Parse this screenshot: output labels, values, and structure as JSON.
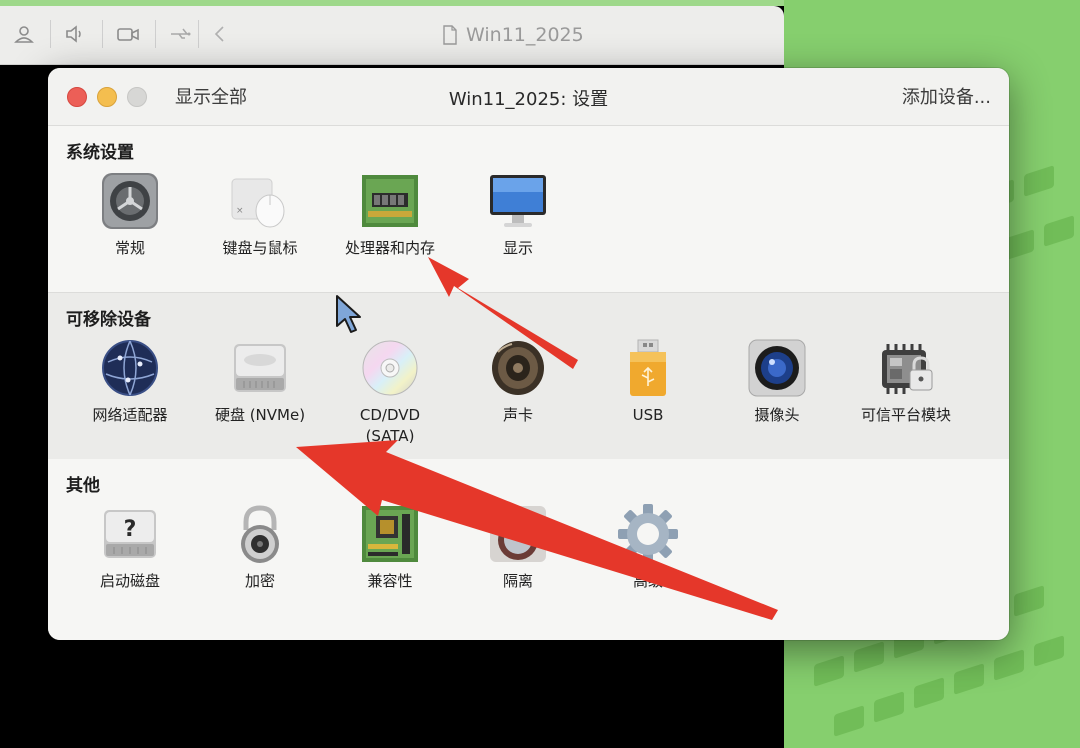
{
  "vm_window": {
    "title": "Win11_2025",
    "toolbar_icons": [
      "user-icon",
      "speaker-icon",
      "camera-icon",
      "usb-icon",
      "back-chevron-icon"
    ]
  },
  "dialog": {
    "show_all_label": "显示全部",
    "title": "Win11_2025: 设置",
    "add_device_label": "添加设备..."
  },
  "sections": {
    "system": {
      "title": "系统设置",
      "items": [
        {
          "label": "常规",
          "icon": "general-gear-icon"
        },
        {
          "label": "键盘与鼠标",
          "icon": "keyboard-mouse-icon"
        },
        {
          "label": "处理器和内存",
          "icon": "cpu-memory-icon"
        },
        {
          "label": "显示",
          "icon": "display-icon"
        }
      ]
    },
    "removable": {
      "title": "可移除设备",
      "items": [
        {
          "label": "网络适配器",
          "icon": "network-globe-icon"
        },
        {
          "label": "硬盘 (NVMe)",
          "icon": "hard-disk-icon"
        },
        {
          "label": "CD/DVD\n(SATA)",
          "icon": "cd-dvd-icon"
        },
        {
          "label": "声卡",
          "icon": "speaker-icon"
        },
        {
          "label": "USB",
          "icon": "usb-drive-icon"
        },
        {
          "label": "摄像头",
          "icon": "webcam-icon"
        },
        {
          "label": "可信平台模块",
          "icon": "tpm-chip-lock-icon"
        }
      ]
    },
    "other": {
      "title": "其他",
      "items": [
        {
          "label": "启动磁盘",
          "icon": "startup-disk-icon"
        },
        {
          "label": "加密",
          "icon": "padlock-icon"
        },
        {
          "label": "兼容性",
          "icon": "motherboard-icon"
        },
        {
          "label": "隔离",
          "icon": "isolation-icon"
        },
        {
          "label": "高级",
          "icon": "advanced-gear-icon"
        }
      ]
    }
  },
  "colors": {
    "annotation_arrow": "#e5372a",
    "desktop_green": "#86cf6e",
    "close": "#ec5f57",
    "minimize": "#f4be4f"
  }
}
